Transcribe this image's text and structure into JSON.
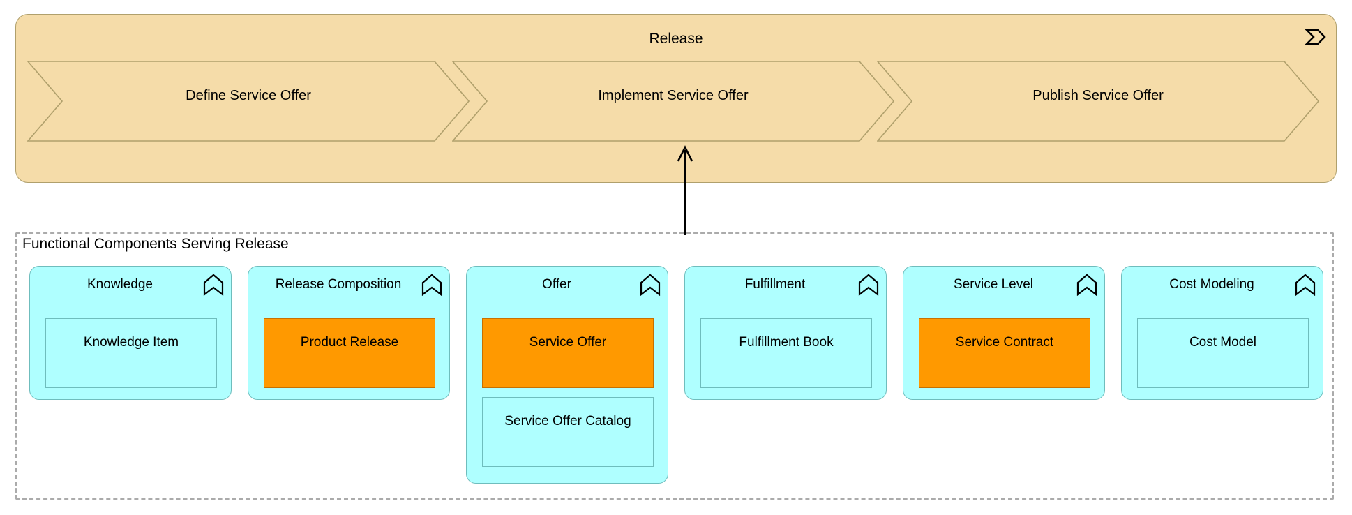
{
  "diagram": {
    "background": "#FFFFFF",
    "colors": {
      "process_fill": "#F5DCA9",
      "process_stroke": "#B0A06C",
      "component_fill": "#AFFFFF",
      "component_stroke": "#6FBDBD",
      "highlight_fill": "#FF9900",
      "highlight_stroke": "#C87000",
      "group_stroke": "#ABABAB",
      "text": "#000000"
    }
  },
  "release_band": {
    "title": "Release",
    "icon": "business-process-chevron-icon",
    "steps": [
      {
        "label": "Define Service Offer"
      },
      {
        "label": "Implement Service Offer"
      },
      {
        "label": "Publish Service Offer"
      }
    ]
  },
  "relationship": {
    "name": "serving-arrow",
    "direction": "up",
    "from": "Functional Components Serving Release",
    "to": "Release"
  },
  "group": {
    "title": "Functional Components Serving Release",
    "components": [
      {
        "title": "Knowledge",
        "icon": "application-function-icon",
        "objects": [
          {
            "label": "Knowledge Item",
            "highlight": false
          }
        ]
      },
      {
        "title": "Release Composition",
        "icon": "application-function-icon",
        "objects": [
          {
            "label": "Product Release",
            "highlight": true
          }
        ]
      },
      {
        "title": "Offer",
        "icon": "application-function-icon",
        "objects": [
          {
            "label": "Service Offer",
            "highlight": true
          },
          {
            "label": "Service Offer Catalog",
            "highlight": false
          }
        ]
      },
      {
        "title": "Fulfillment",
        "icon": "application-function-icon",
        "objects": [
          {
            "label": "Fulfillment Book",
            "highlight": false
          }
        ]
      },
      {
        "title": "Service Level",
        "icon": "application-function-icon",
        "objects": [
          {
            "label": "Service Contract",
            "highlight": true
          }
        ]
      },
      {
        "title": "Cost Modeling",
        "icon": "application-function-icon",
        "objects": [
          {
            "label": "Cost Model",
            "highlight": false
          }
        ]
      }
    ]
  }
}
